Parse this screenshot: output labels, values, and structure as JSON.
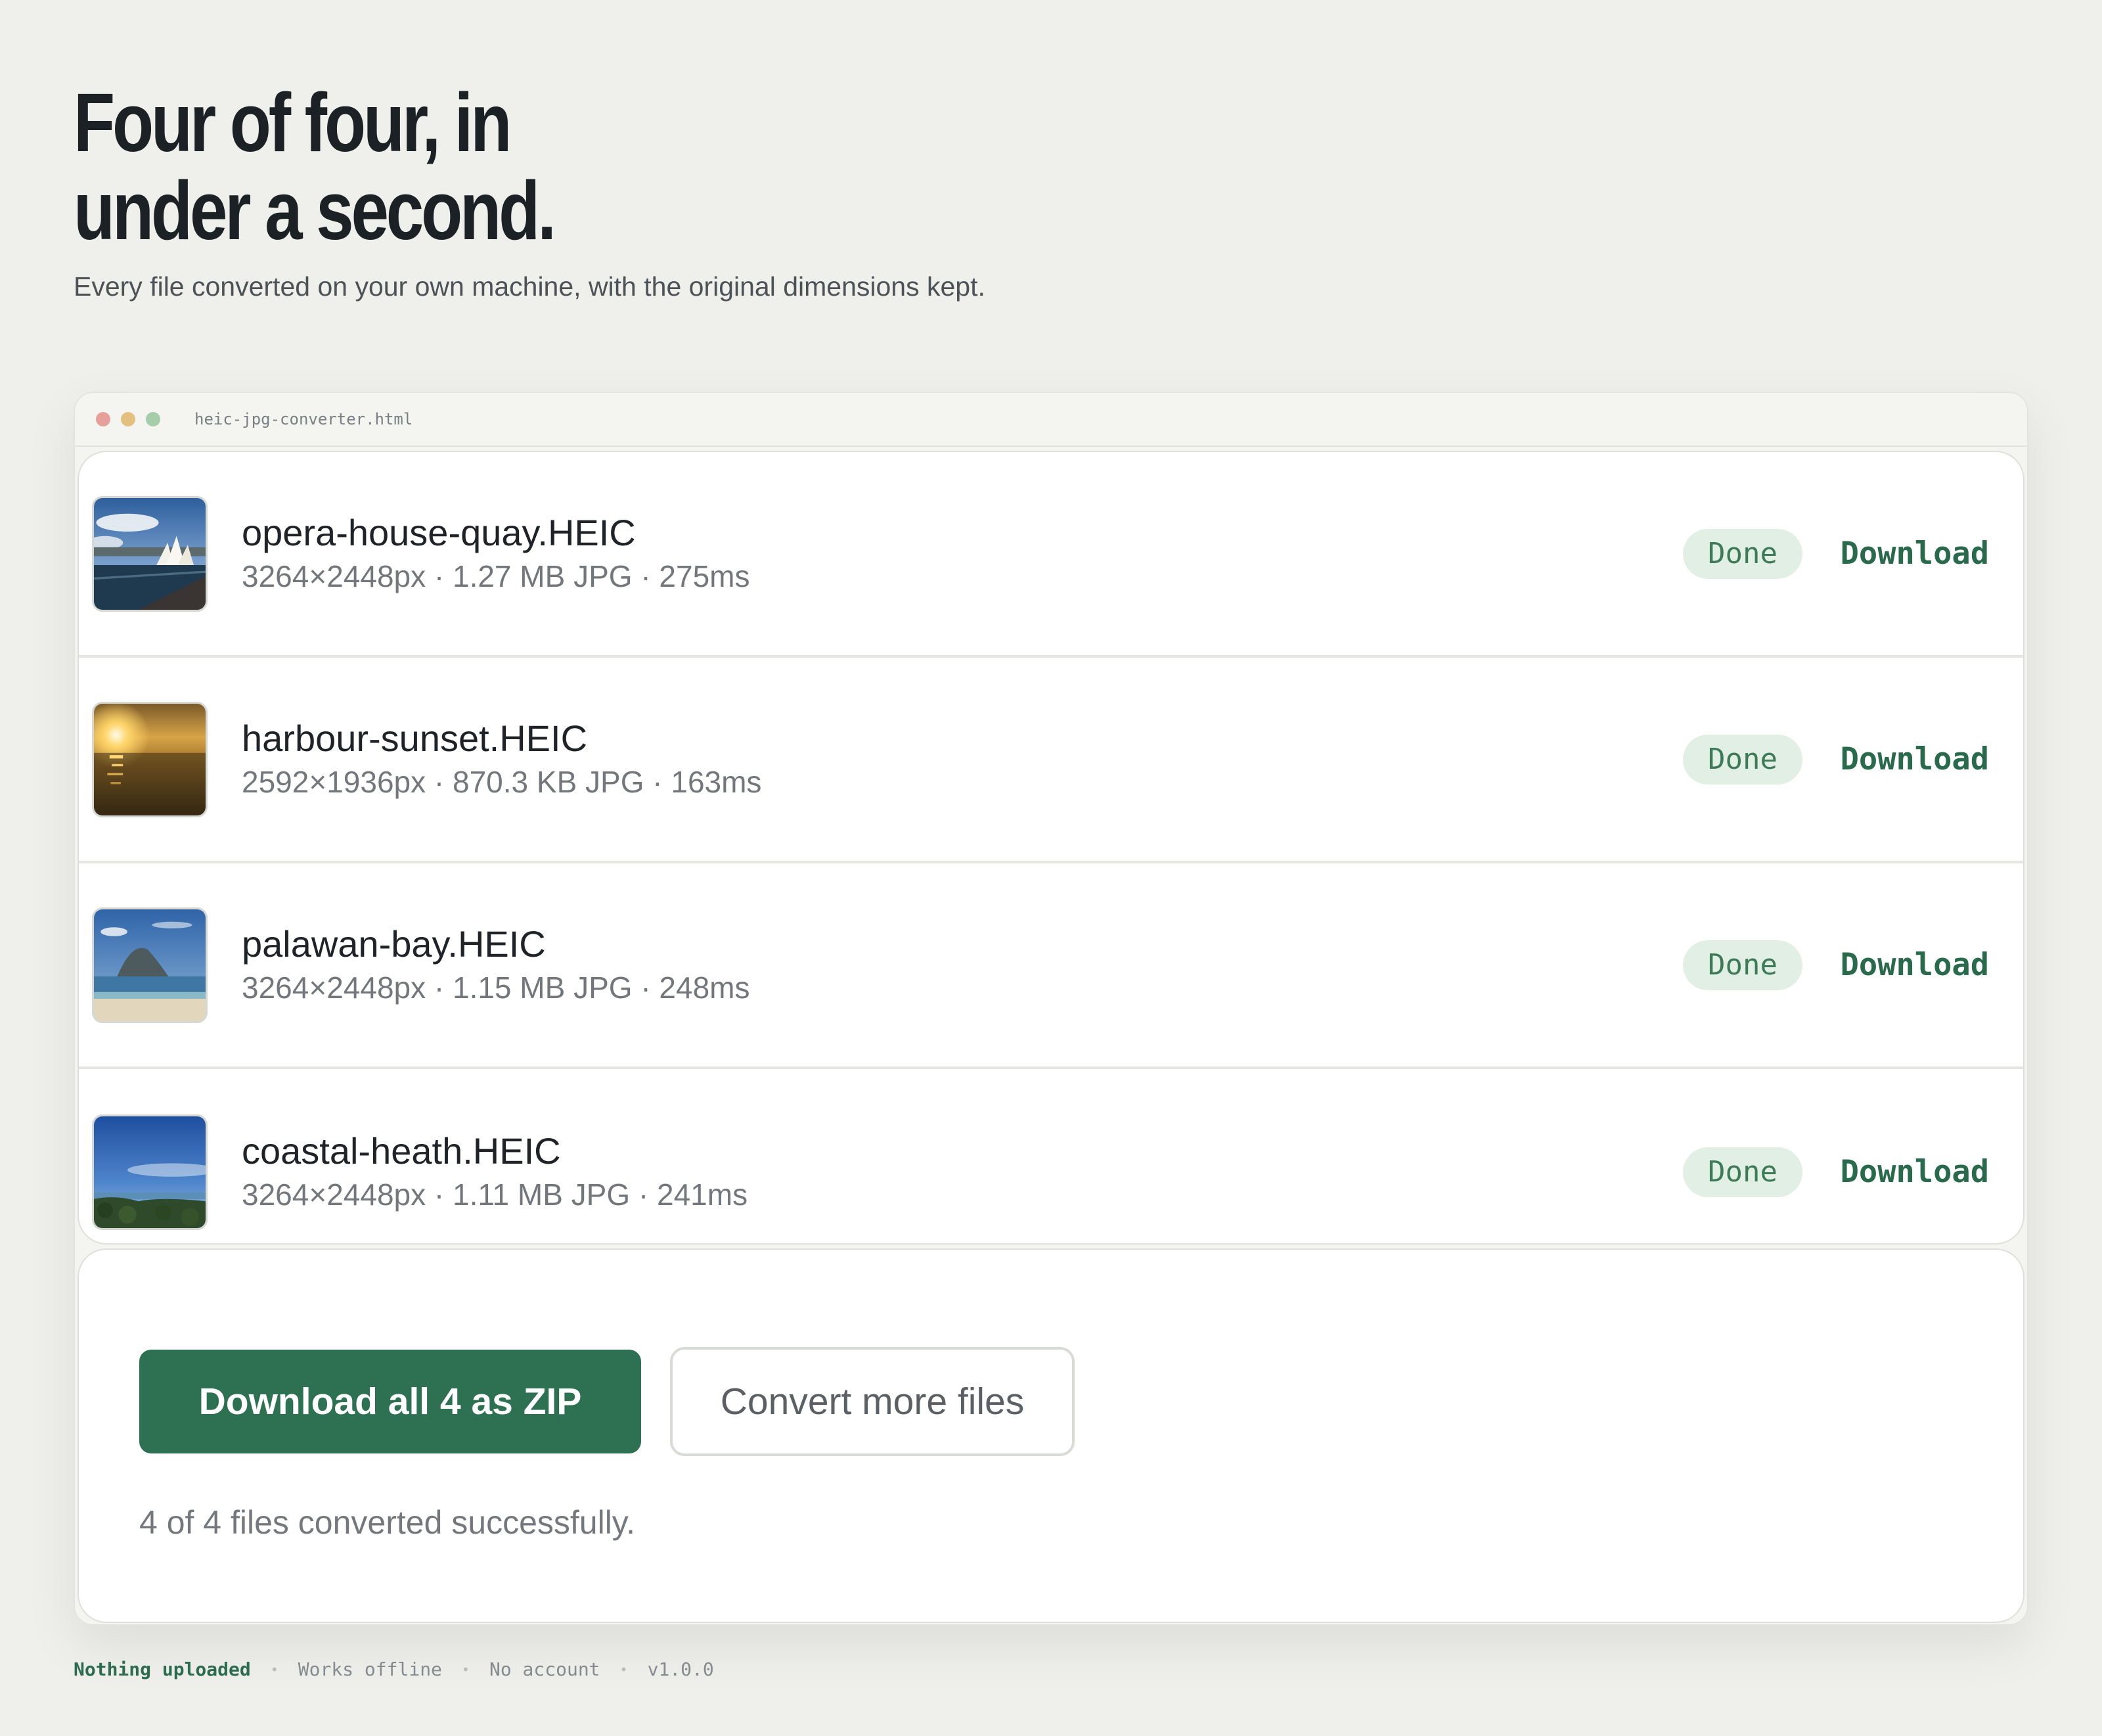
{
  "hero": {
    "title_line1": "Four of four, in",
    "title_line2": "under a second.",
    "subtitle": "Every file converted on your own machine, with the original dimensions kept."
  },
  "window": {
    "filename": "heic-jpg-converter.html"
  },
  "files": [
    {
      "name": "opera-house-quay.HEIC",
      "meta": "3264×2448px · 1.27 MB JPG · 275ms",
      "status": "Done",
      "action": "Download",
      "thumbnail": "opera-house-harbour-photo"
    },
    {
      "name": "harbour-sunset.HEIC",
      "meta": "2592×1936px · 870.3 KB JPG · 163ms",
      "status": "Done",
      "action": "Download",
      "thumbnail": "sunset-over-water-photo"
    },
    {
      "name": "palawan-bay.HEIC",
      "meta": "3264×2448px · 1.15 MB JPG · 248ms",
      "status": "Done",
      "action": "Download",
      "thumbnail": "island-bay-beach-photo"
    },
    {
      "name": "coastal-heath.HEIC",
      "meta": "3264×2448px · 1.11 MB JPG · 241ms",
      "status": "Done",
      "action": "Download",
      "thumbnail": "coastal-sky-heath-photo"
    }
  ],
  "actions": {
    "download_all": "Download all 4 as ZIP",
    "convert_more": "Convert more files",
    "status": "4 of 4 files converted successfully."
  },
  "footer": {
    "items": [
      "Nothing uploaded",
      "Works offline",
      "No account",
      "v1.0.0"
    ],
    "separator": "•"
  },
  "colors": {
    "accent": "#2d7052",
    "badge_bg": "#e2efe4",
    "page_bg": "#eff0eb"
  }
}
